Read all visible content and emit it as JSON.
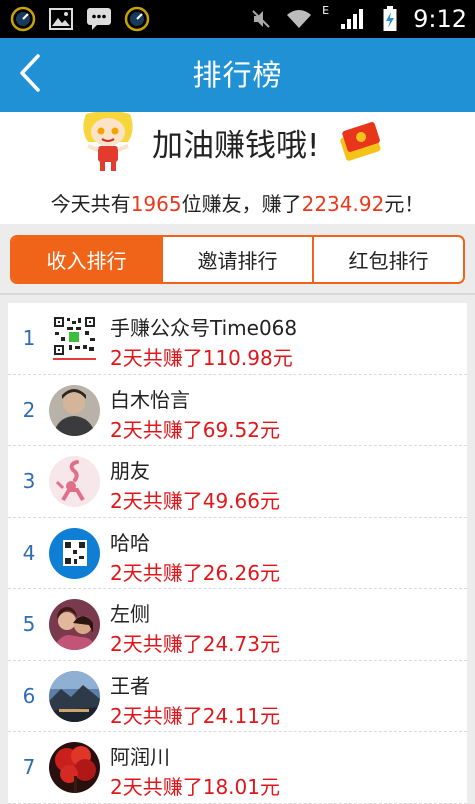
{
  "status_bar": {
    "time": "9:12",
    "network_letter": "E",
    "icons": [
      "speedometer-icon",
      "image-icon",
      "message-icon",
      "speedometer-icon",
      "mute-icon",
      "wifi-icon",
      "signal-icon",
      "battery-charging-icon"
    ]
  },
  "navbar": {
    "title": "排行榜",
    "back_icon": "chevron-left-icon",
    "color": "#2191d6"
  },
  "banner": {
    "headline": "加油赚钱哦!",
    "summary_prefix": "今天共有",
    "user_count": "1965",
    "summary_mid": "位赚友，赚了",
    "total_amount": "2234.92",
    "summary_suffix": "元！",
    "highlight_color": "#e8391d"
  },
  "tabs": [
    {
      "label": "收入排行",
      "active": true
    },
    {
      "label": "邀请排行",
      "active": false
    },
    {
      "label": "红包排行",
      "active": false
    }
  ],
  "accent_color": "#f06419",
  "ranking": [
    {
      "rank": "1",
      "name": "手赚公众号Time068",
      "earnings": "2天共赚了110.98元",
      "avatar": "qr-code-avatar"
    },
    {
      "rank": "2",
      "name": "白木怡言",
      "earnings": "2天共赚了69.52元",
      "avatar": "portrait-avatar"
    },
    {
      "rank": "3",
      "name": "朋友",
      "earnings": "2天共赚了49.66元",
      "avatar": "pink-cartoon-avatar"
    },
    {
      "rank": "4",
      "name": "哈哈",
      "earnings": "2天共赚了26.26元",
      "avatar": "blue-qr-avatar"
    },
    {
      "rank": "5",
      "name": "左侧",
      "earnings": "2天共赚了24.73元",
      "avatar": "couple-photo-avatar"
    },
    {
      "rank": "6",
      "name": "王者",
      "earnings": "2天共赚了24.11元",
      "avatar": "landscape-avatar"
    },
    {
      "rank": "7",
      "name": "阿润川",
      "earnings": "2天共赚了18.01元",
      "avatar": "red-tree-avatar"
    }
  ]
}
